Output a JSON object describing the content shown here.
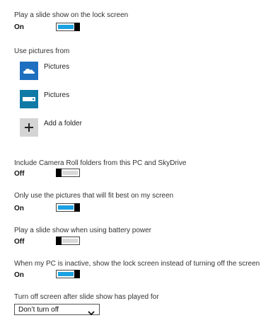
{
  "slideshow": {
    "label": "Play a slide show on the lock screen",
    "state": "On",
    "on": true
  },
  "pictures": {
    "label": "Use pictures from",
    "items": [
      {
        "label": "Pictures",
        "icon": "skydrive-cloud-icon",
        "color": "#1e6fbf"
      },
      {
        "label": "Pictures",
        "icon": "drive-icon",
        "color": "#0f7aa6"
      },
      {
        "label": "Add a folder",
        "icon": "plus-icon",
        "color": "#d4d4d4"
      }
    ]
  },
  "camera_roll": {
    "label": "Include Camera Roll folders from this PC and SkyDrive",
    "state": "Off",
    "on": false
  },
  "fit_best": {
    "label": "Only use the pictures that will fit best on my screen",
    "state": "On",
    "on": true
  },
  "battery": {
    "label": "Play a slide show when using battery power",
    "state": "Off",
    "on": false
  },
  "inactive": {
    "label": "When my PC is inactive, show the lock screen instead of turning off the screen",
    "state": "On",
    "on": true
  },
  "turn_off": {
    "label": "Turn off screen after slide show has played for",
    "value": "Don’t turn off"
  },
  "colors": {
    "accent": "#1ba1e2",
    "toggle_off": "#d9d9d9"
  }
}
